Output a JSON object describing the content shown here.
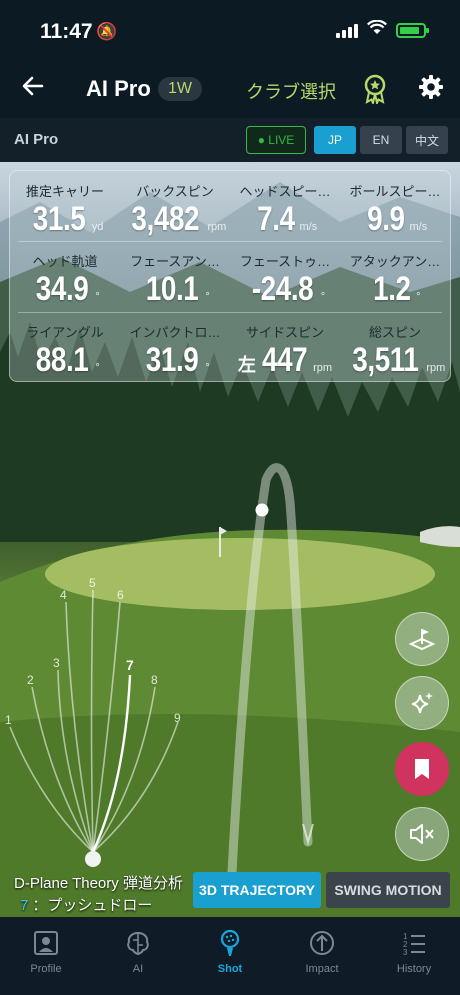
{
  "status": {
    "time": "11:47"
  },
  "nav": {
    "title": "AI Pro",
    "club": "1W",
    "club_select": "クラブ選択"
  },
  "subbar": {
    "title": "AI Pro",
    "live": "● LIVE",
    "langs": [
      "JP",
      "EN",
      "中文"
    ]
  },
  "metrics": [
    [
      {
        "label": "推定キャリー",
        "value": "31.5",
        "unit": "yd"
      },
      {
        "label": "バックスピン",
        "value": "3,482",
        "unit": "rpm"
      },
      {
        "label": "ヘッドスピー…",
        "value": "7.4",
        "unit": "m/s"
      },
      {
        "label": "ボールスピー…",
        "value": "9.9",
        "unit": "m/s"
      }
    ],
    [
      {
        "label": "ヘッド軌道",
        "value": "34.9",
        "unit": "°"
      },
      {
        "label": "フェースアン…",
        "value": "10.1",
        "unit": "°"
      },
      {
        "label": "フェーストゥ…",
        "value": "-24.8",
        "unit": "°"
      },
      {
        "label": "アタックアン…",
        "value": "1.2",
        "unit": "°"
      }
    ],
    [
      {
        "label": "ライアングル",
        "value": "88.1",
        "unit": "°"
      },
      {
        "label": "インパクトロ…",
        "value": "31.9",
        "unit": "°"
      },
      {
        "label": "サイドスピン",
        "prefix": "左",
        "value": "447",
        "unit": "rpm"
      },
      {
        "label": "総スピン",
        "value": "3,511",
        "unit": "rpm"
      }
    ]
  ],
  "dplane": {
    "title": "D-Plane Theory 弾道分析",
    "num": "7",
    "desc": "：プッシュドロー",
    "fan_labels": [
      "1",
      "2",
      "3",
      "4",
      "5",
      "6",
      "7",
      "8",
      "9"
    ]
  },
  "buttons": {
    "trajectory": "3D TRAJECTORY",
    "swing": "SWING MOTION"
  },
  "tabs": [
    {
      "label": "Profile",
      "icon": "profile-icon"
    },
    {
      "label": "AI",
      "icon": "ai-brain-icon"
    },
    {
      "label": "Shot",
      "icon": "shot-icon"
    },
    {
      "label": "Impact",
      "icon": "impact-icon"
    },
    {
      "label": "History",
      "icon": "history-icon"
    }
  ],
  "colors": {
    "accent": "#1a9fd1",
    "club": "#b6d96a",
    "bookmark": "#d0335e",
    "live": "#3ab54a"
  }
}
